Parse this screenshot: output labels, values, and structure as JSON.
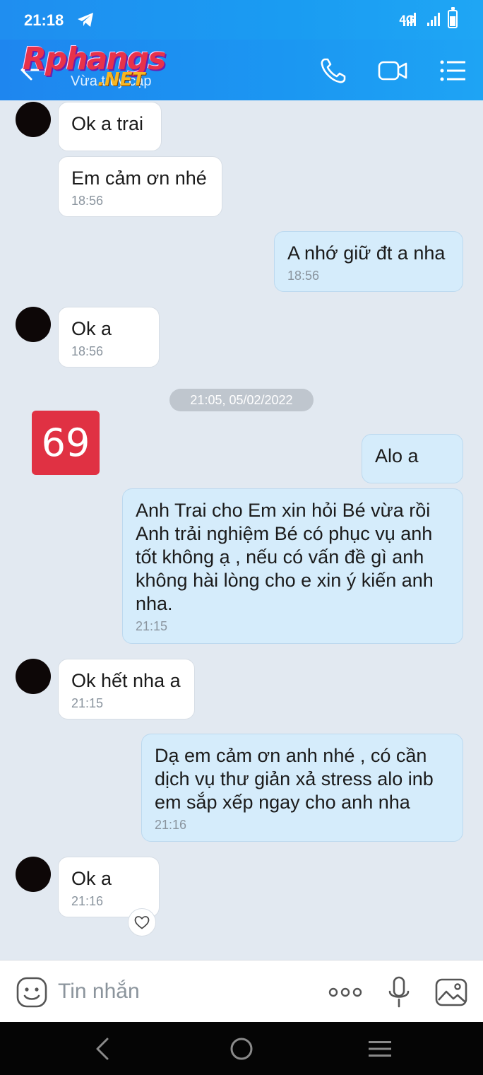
{
  "status_bar": {
    "time": "21:18",
    "network": "4G"
  },
  "header": {
    "subtitle": "Vừa truy cập",
    "watermark": "Rphangs",
    "watermark_tld": ".NET"
  },
  "chat": {
    "messages": [
      {
        "dir": "in",
        "text": "Ok a trai",
        "time": ""
      },
      {
        "dir": "in",
        "text": "Em cảm ơn nhé",
        "time": "18:56"
      },
      {
        "dir": "out",
        "text": "A nhớ giữ đt a nha",
        "time": "18:56"
      },
      {
        "dir": "in",
        "text": "Ok a",
        "time": "18:56"
      },
      {
        "dir": "out",
        "text": "Alo a",
        "time": ""
      },
      {
        "dir": "out",
        "text": "Anh Trai cho Em xin hỏi Bé vừa rồi Anh trải nghiệm Bé có phục vụ anh tốt không ạ , nếu có vấn đề gì anh không hài lòng cho e xin ý kiến anh nha.",
        "time": "21:15"
      },
      {
        "dir": "in",
        "text": "Ok hết nha a",
        "time": "21:15"
      },
      {
        "dir": "out",
        "text": "Dạ em cảm ơn anh nhé , có cần dịch vụ thư giản xả stress alo inb em sắp xếp ngay cho anh nha",
        "time": "21:16"
      },
      {
        "dir": "in",
        "text": "Ok a",
        "time": "21:16"
      }
    ],
    "date_separator": "21:05, 05/02/2022",
    "sticker_text": "69"
  },
  "composer": {
    "placeholder": "Tin nhắn"
  },
  "icons": {
    "back": "arrow-left-icon",
    "call": "phone-icon",
    "video": "video-camera-icon",
    "menu": "list-menu-icon",
    "emoji": "emoji-icon",
    "more": "more-dots-icon",
    "mic": "microphone-icon",
    "image": "image-icon",
    "heart": "heart-icon",
    "nav_back": "chevron-left-icon",
    "nav_home": "circle-home-icon",
    "nav_recents": "hamburger-icon"
  },
  "colors": {
    "header": "#1b97f2",
    "outgoing_bubble": "#d5ecfb",
    "incoming_bubble": "#ffffff",
    "chat_bg": "#e2e9f1",
    "sticker": "#e03143"
  }
}
